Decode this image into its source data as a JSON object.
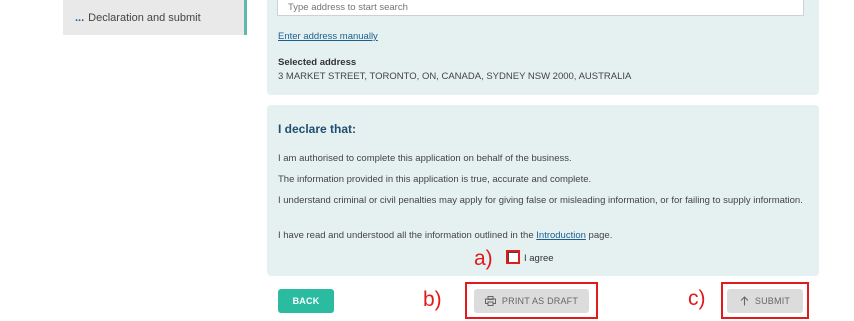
{
  "sidebar": {
    "item_label": "Declaration and submit",
    "dots": "..."
  },
  "address": {
    "search_placeholder": "Type address to start search",
    "enter_manually": "Enter address manually",
    "selected_label": "Selected address",
    "selected_value": "3 MARKET STREET, TORONTO, ON, CANADA, SYDNEY NSW 2000, AUSTRALIA"
  },
  "declaration": {
    "title": "I declare that:",
    "statements": [
      "I am authorised to complete this application on behalf of the business.",
      "The information provided in this application is true, accurate and complete.",
      "I understand criminal or civil penalties may apply for giving false or misleading information, or for failing to supply information."
    ],
    "last_prefix": "I have read and understood all the information outlined in the ",
    "last_link": "Introduction",
    "last_suffix": " page.",
    "agree_label": "I agree"
  },
  "buttons": {
    "back": "BACK",
    "print_draft": "PRINT AS DRAFT",
    "submit": "SUBMIT"
  },
  "annotations": {
    "a": "a)",
    "b": "b)",
    "c": "c)"
  },
  "icons": {
    "sidebar": "ellipsis-icon",
    "print": "printer-icon",
    "submit": "arrow-up-icon"
  },
  "colors": {
    "accent": "#2bbba0",
    "highlight": "#e01b1b",
    "panel": "#e5f1f1",
    "link": "#1c5f8f"
  }
}
